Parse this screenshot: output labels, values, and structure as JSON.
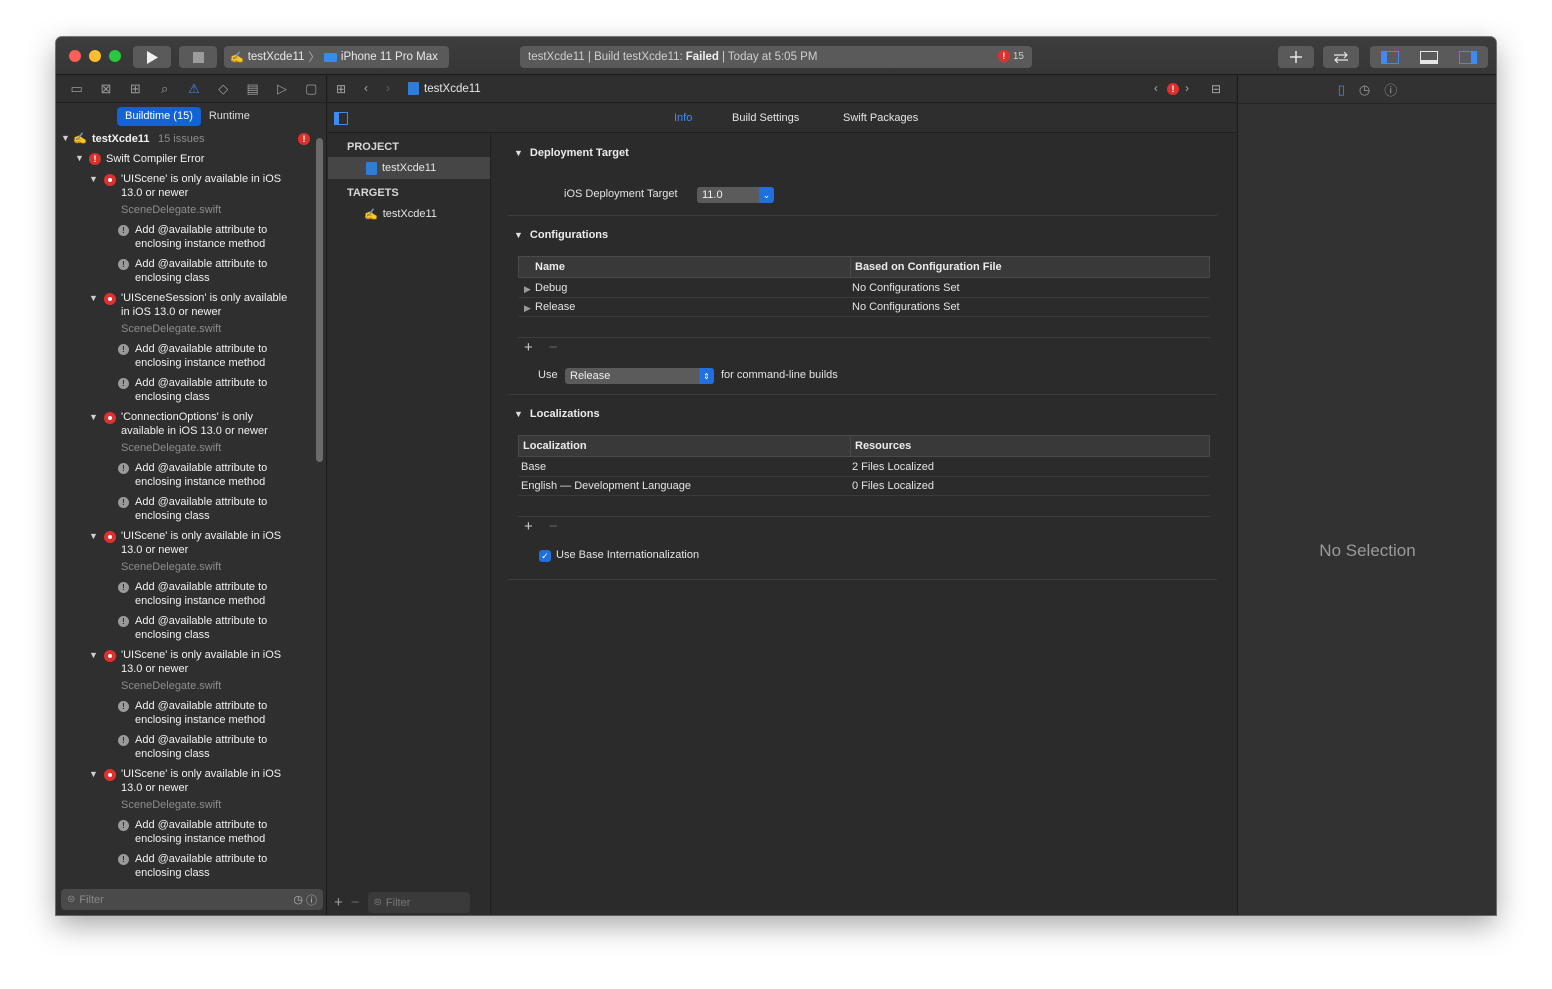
{
  "toolbar": {
    "scheme_name": "testXcde11",
    "scheme_separator": "〉",
    "device": "iPhone 11 Pro Max",
    "status_prefix": "testXcde11 | Build testXcde11:",
    "status_result": "Failed",
    "status_suffix": "| Today at 5:05 PM",
    "error_count": "15",
    "error_mark": "!"
  },
  "navigator": {
    "segments": [
      "Buildtime (15)",
      "Runtime"
    ],
    "root": {
      "name": "testXcde11",
      "count": "15 issues"
    },
    "category": "Swift Compiler Error",
    "issues": [
      {
        "line1": "'UIScene' is only available in iOS",
        "line2": "13.0 or newer",
        "file": "SceneDelegate.swift"
      },
      {
        "line1": "'UISceneSession' is only available",
        "line2": "in iOS 13.0 or newer",
        "file": "SceneDelegate.swift"
      },
      {
        "line1": "'ConnectionOptions' is only",
        "line2": "available in iOS 13.0 or newer",
        "file": "SceneDelegate.swift"
      },
      {
        "line1": "'UIScene' is only available in iOS",
        "line2": "13.0 or newer",
        "file": "SceneDelegate.swift"
      },
      {
        "line1": "'UIScene' is only available in iOS",
        "line2": "13.0 or newer",
        "file": "SceneDelegate.swift"
      },
      {
        "line1": "'UIScene' is only available in iOS",
        "line2": "13.0 or newer",
        "file": "SceneDelegate.swift"
      }
    ],
    "notes": [
      {
        "line1": "Add @available attribute to",
        "line2": "enclosing instance method"
      },
      {
        "line1": "Add @available attribute to",
        "line2": "enclosing class"
      }
    ],
    "filter_placeholder": "Filter"
  },
  "jumpbar": {
    "file": "testXcde11"
  },
  "tabs": [
    "Info",
    "Build Settings",
    "Swift Packages"
  ],
  "project_list": {
    "project_header": "PROJECT",
    "project_item": "testXcde11",
    "targets_header": "TARGETS",
    "target_item": "testXcde11",
    "filter_placeholder": "Filter"
  },
  "info": {
    "deployment": {
      "title": "Deployment Target",
      "label": "iOS Deployment Target",
      "value": "11.0"
    },
    "configurations": {
      "title": "Configurations",
      "headers": [
        "Name",
        "Based on Configuration File"
      ],
      "rows": [
        {
          "name": "Debug",
          "file": "No Configurations Set"
        },
        {
          "name": "Release",
          "file": "No Configurations Set"
        }
      ],
      "use_label": "Use",
      "use_value": "Release",
      "use_suffix": "for command-line builds"
    },
    "localizations": {
      "title": "Localizations",
      "headers": [
        "Localization",
        "Resources"
      ],
      "rows": [
        {
          "name": "Base",
          "resources": "2 Files Localized"
        },
        {
          "name": "English — Development Language",
          "resources": "0 Files Localized"
        }
      ],
      "checkbox_label": "Use Base Internationalization",
      "checkbox_checked": true
    }
  },
  "inspector": {
    "empty_text": "No Selection"
  }
}
